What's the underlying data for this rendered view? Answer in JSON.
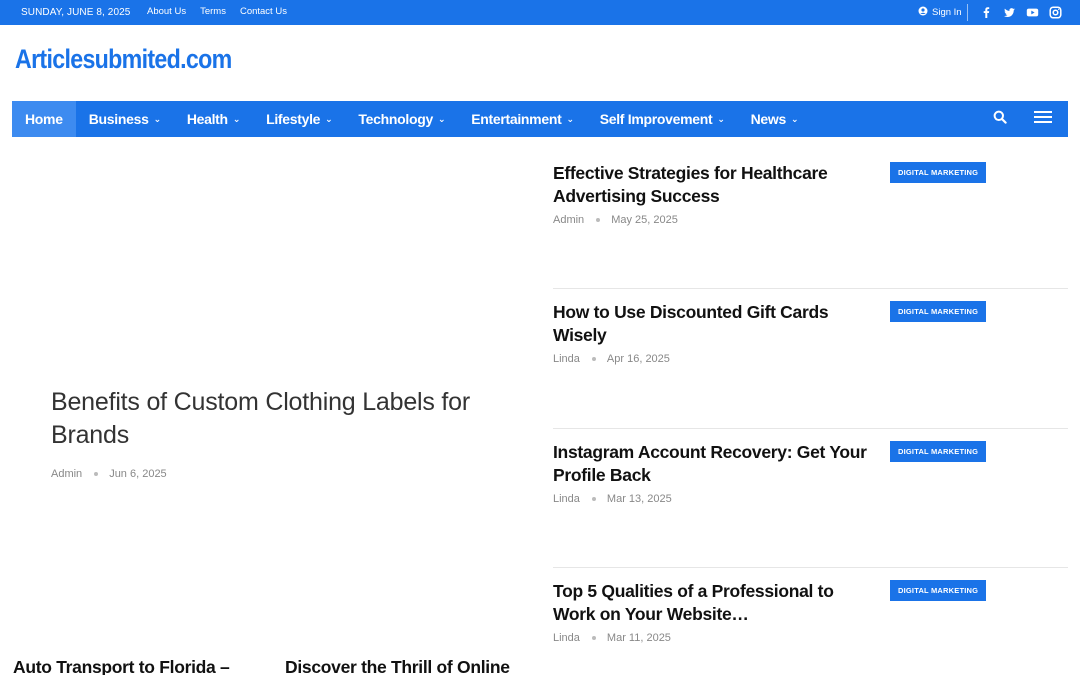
{
  "topbar": {
    "date": "SUNDAY, JUNE 8, 2025",
    "links": [
      "About Us",
      "Terms",
      "Contact Us"
    ],
    "signin": "Sign In",
    "social_icons": [
      "facebook-icon",
      "twitter-icon",
      "youtube-icon",
      "instagram-icon"
    ]
  },
  "logo": "Articlesubmited.com",
  "nav": {
    "items": [
      {
        "label": "Home",
        "active": true,
        "dropdown": false
      },
      {
        "label": "Business",
        "dropdown": true
      },
      {
        "label": "Health",
        "dropdown": true
      },
      {
        "label": "Lifestyle",
        "dropdown": true
      },
      {
        "label": "Technology",
        "dropdown": true
      },
      {
        "label": "Entertainment",
        "dropdown": true
      },
      {
        "label": "Self Improvement",
        "dropdown": true
      },
      {
        "label": "News",
        "dropdown": true
      }
    ]
  },
  "featured": {
    "title": "Benefits of Custom Clothing Labels for Brands",
    "author": "Admin",
    "date": "Jun 6, 2025"
  },
  "posts": [
    {
      "title": "Effective Strategies for Healthcare Advertising Success",
      "author": "Admin",
      "date": "May 25, 2025",
      "category": "DIGITAL MARKETING"
    },
    {
      "title": "How to Use Discounted Gift Cards Wisely",
      "author": "Linda",
      "date": "Apr 16, 2025",
      "category": "DIGITAL MARKETING"
    },
    {
      "title": "Instagram Account Recovery: Get Your Profile Back",
      "author": "Linda",
      "date": "Mar 13, 2025",
      "category": "DIGITAL MARKETING"
    },
    {
      "title": "Top 5 Qualities of a Professional to Work on Your Website…",
      "author": "Linda",
      "date": "Mar 11, 2025",
      "category": "DIGITAL MARKETING"
    }
  ],
  "bottom": [
    {
      "title": "Auto Transport to Florida –"
    },
    {
      "title": "Discover the Thrill of Online"
    }
  ],
  "colors": {
    "accent": "#1a73e8"
  }
}
